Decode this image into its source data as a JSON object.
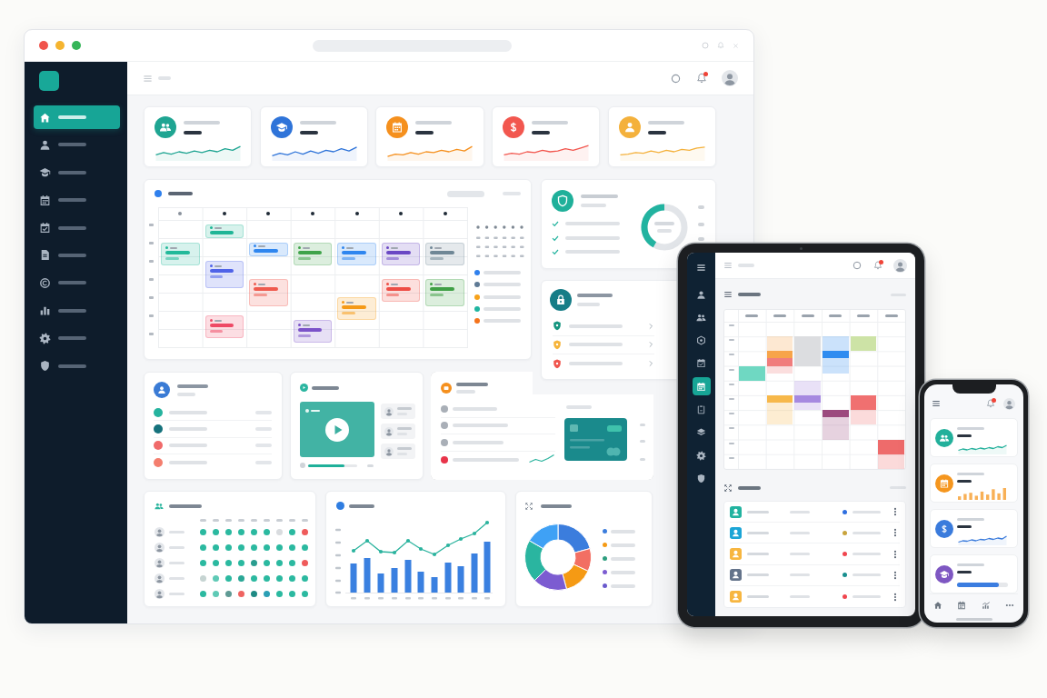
{
  "sidebar": {
    "items": [
      {
        "selected": true
      },
      {
        "selected": false
      },
      {
        "selected": false
      },
      {
        "selected": false
      },
      {
        "selected": false
      },
      {
        "selected": false
      },
      {
        "selected": false
      },
      {
        "selected": false
      },
      {
        "selected": false
      },
      {
        "selected": false
      }
    ]
  },
  "header": {
    "notifications": {
      "unread": true
    }
  },
  "stats": [
    {
      "color": "#1fa592"
    },
    {
      "color": "#2f74d9"
    },
    {
      "color": "#f5901e"
    },
    {
      "color": "#f2574f"
    },
    {
      "color": "#f4b13c"
    }
  ],
  "calendar": {
    "events": [
      {
        "color": "#22b99a"
      },
      {
        "color": "#1fb596"
      },
      {
        "color": "#4f63e8"
      },
      {
        "color": "#ee4a66"
      },
      {
        "color": "#2f86ef"
      },
      {
        "color": "#ef5a4e"
      },
      {
        "color": "#3fa34a"
      },
      {
        "color": "#7b52c9"
      },
      {
        "color": "#2f86ef"
      },
      {
        "color": "#f59a17"
      },
      {
        "color": "#6a48c4"
      },
      {
        "color": "#ee4d45"
      },
      {
        "color": "#6f8796"
      },
      {
        "color": "#3f9f45"
      }
    ],
    "legend": [
      {
        "color": "#2f80ed"
      },
      {
        "color": "#5f7a95"
      },
      {
        "color": "#f7a21b"
      },
      {
        "color": "#1fb5a0"
      },
      {
        "color": "#f5731b"
      }
    ]
  },
  "security": {
    "level": 0.42,
    "checks": [
      {
        "checked": true
      },
      {
        "checked": true
      },
      {
        "checked": true
      }
    ]
  },
  "protection": {
    "items": [
      {
        "color": "#15957f"
      },
      {
        "color": "#f6b43a"
      },
      {
        "color": "#f0544c"
      }
    ]
  },
  "contacts": {
    "items": [
      {
        "color": "#25b39e"
      },
      {
        "color": "#16727c"
      },
      {
        "color": "#f06a6a"
      },
      {
        "color": "#f47e6e"
      }
    ]
  },
  "video": {
    "level": 0.74
  },
  "payments": {
    "items": [
      {
        "color": "#a9afb7"
      },
      {
        "color": "#a9afb7"
      },
      {
        "color": "#a9afb7"
      },
      {
        "color": "#e8344a"
      }
    ]
  },
  "attendance": {
    "rows": [
      {
        "cells": [
          {
            "color": "#2bb9a0"
          },
          {
            "color": "#2bb9a0"
          },
          {
            "color": "#2bb9a0"
          },
          {
            "color": "#2bb9a0"
          },
          {
            "color": "#2bb9a0"
          },
          {
            "color": "#2bb9a0"
          },
          {
            "color": "#d9dcdf"
          },
          {
            "color": "#2bb9a0"
          },
          {
            "color": "#ef5b5b"
          }
        ]
      },
      {
        "cells": [
          {
            "color": "#2bb9a0"
          },
          {
            "color": "#2bb9a0"
          },
          {
            "color": "#2bb9a0"
          },
          {
            "color": "#2bb9a0"
          },
          {
            "color": "#2bb9a0"
          },
          {
            "color": "#2bb9a0"
          },
          {
            "color": "#2bb9a0"
          },
          {
            "color": "#2bb9a0"
          },
          {
            "color": "#2bb9a0"
          }
        ]
      },
      {
        "cells": [
          {
            "color": "#2bb9a0"
          },
          {
            "color": "#2bb9a0"
          },
          {
            "color": "#2bb9a0"
          },
          {
            "color": "#2bb9a0"
          },
          {
            "color": "#2a9d8f"
          },
          {
            "color": "#2bb9a0"
          },
          {
            "color": "#2bb9a0"
          },
          {
            "color": "#2bb9a0"
          },
          {
            "color": "#ef5b5b"
          }
        ]
      },
      {
        "cells": [
          {
            "color": "#c6d4d2"
          },
          {
            "color": "#5fcab6"
          },
          {
            "color": "#2bb9a0"
          },
          {
            "color": "#2aa796"
          },
          {
            "color": "#2bb9a0"
          },
          {
            "color": "#2bb9a0"
          },
          {
            "color": "#2bb9a0"
          },
          {
            "color": "#2bb9a0"
          },
          {
            "color": "#2bb9a0"
          }
        ]
      },
      {
        "cells": [
          {
            "color": "#2bb9a0"
          },
          {
            "color": "#5fcab6"
          },
          {
            "color": "#5f9a94"
          },
          {
            "color": "#ef6461"
          },
          {
            "color": "#1e8a84"
          },
          {
            "color": "#2b9fb5"
          },
          {
            "color": "#2bb9a0"
          },
          {
            "color": "#2bb9a0"
          },
          {
            "color": "#2bb9a0"
          }
        ]
      }
    ]
  },
  "donut": {
    "legend": [
      {
        "color": "#3b7ddd"
      },
      {
        "color": "#f59a14"
      },
      {
        "color": "#2e9e7f"
      },
      {
        "color": "#7c5cd1"
      },
      {
        "color": "#6a5acd"
      }
    ]
  },
  "tablet": {
    "sidebar": {
      "items": [
        {
          "selected": false
        },
        {
          "selected": false
        },
        {
          "selected": false
        },
        {
          "selected": false
        },
        {
          "selected": true
        },
        {
          "selected": false
        },
        {
          "selected": false
        },
        {
          "selected": false
        },
        {
          "selected": false
        }
      ]
    },
    "notifications": {
      "unread": true
    },
    "events": [
      {
        "color": "#6fd8c2"
      },
      {
        "color": "#f7a44a"
      },
      {
        "color": "#f07d7d"
      },
      {
        "color": "#dcdde0"
      },
      {
        "color": "#2f8cf0"
      },
      {
        "color": "#cde3a6"
      },
      {
        "color": "#a689e0"
      },
      {
        "color": "#f7b84a"
      },
      {
        "color": "#9c4a7e"
      },
      {
        "color": "#f07070"
      },
      {
        "color": "#ee6b6b"
      }
    ],
    "team": [
      {
        "avatar": {
          "color": "#22b3a0"
        },
        "status": {
          "color": "#2f6fe0"
        }
      },
      {
        "avatar": {
          "color": "#1ba5d6"
        },
        "status": {
          "color": "#c9a43d"
        }
      },
      {
        "avatar": {
          "color": "#f7b640"
        },
        "status": {
          "color": "#f0464f"
        }
      },
      {
        "avatar": {
          "color": "#64748b"
        },
        "status": {
          "color": "#198f8f"
        }
      },
      {
        "avatar": {
          "color": "#f7b640"
        },
        "status": {
          "color": "#f0464f"
        }
      }
    ]
  },
  "phone": {
    "notifications": {
      "unread": true
    },
    "cards": [
      {
        "kind": "sparkline",
        "color": "#22b09b"
      },
      {
        "kind": "bars",
        "color": "#f5961e"
      },
      {
        "kind": "sparkline",
        "color": "#3a7bdc"
      },
      {
        "kind": "progress",
        "color": "#7e57c2",
        "level": 0.82
      }
    ]
  }
}
